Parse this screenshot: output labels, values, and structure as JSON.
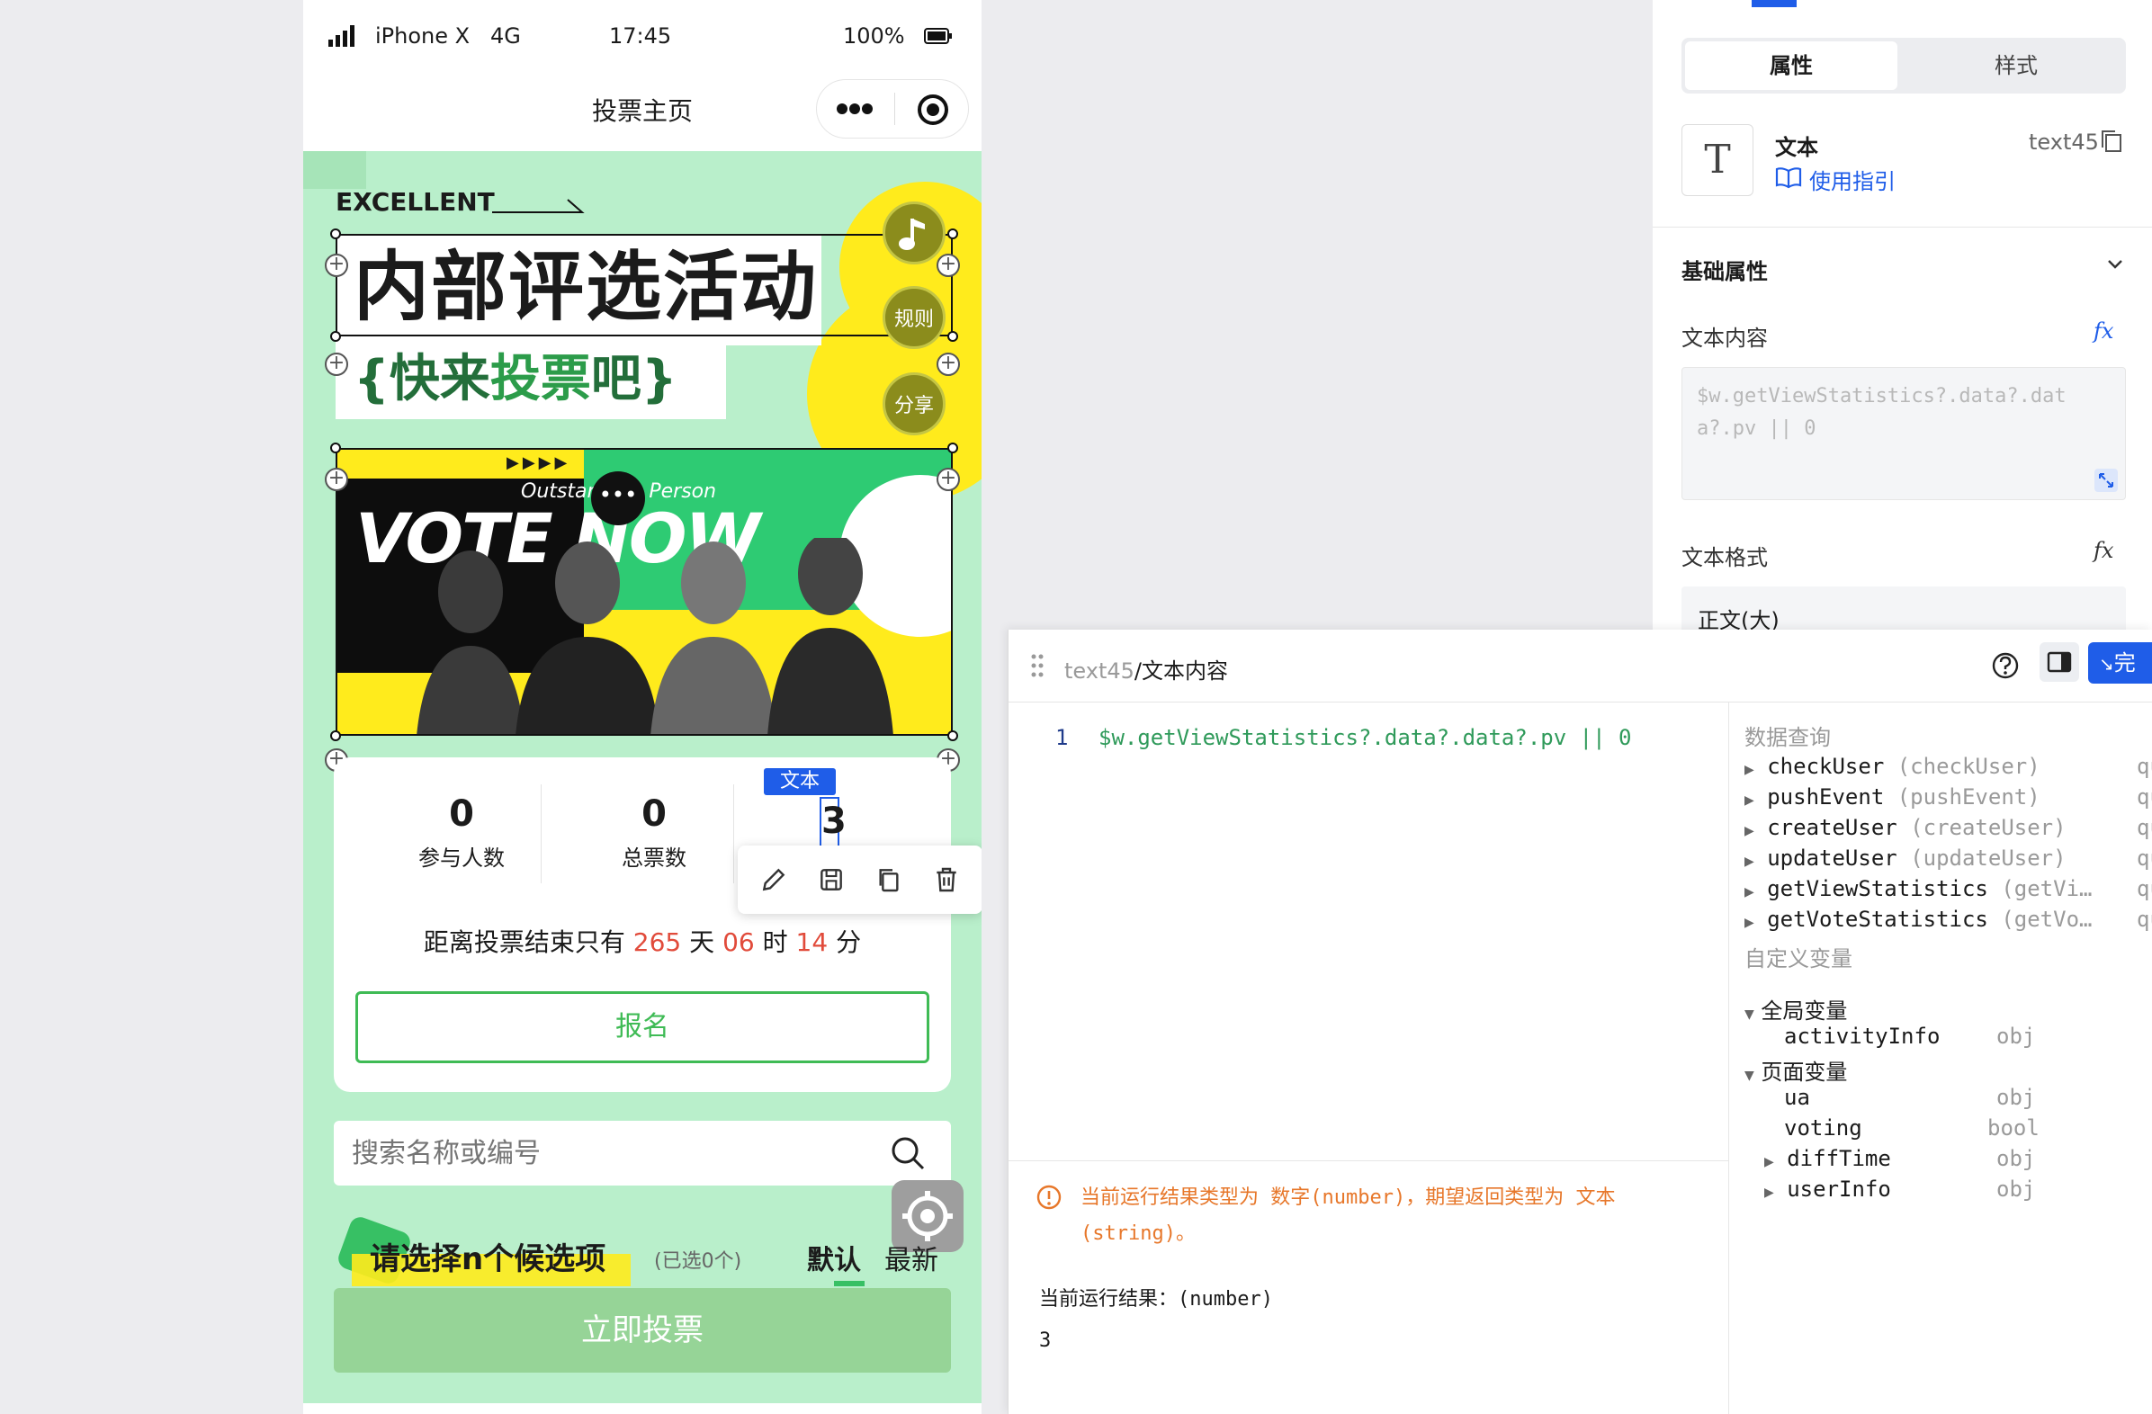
{
  "status_bar": {
    "carrier": "iPhone X",
    "network": "4G",
    "time": "17:45",
    "battery": "100%"
  },
  "nav": {
    "title": "投票主页"
  },
  "hero": {
    "tag": "EXCELLENT",
    "title": "内部评选活动",
    "subtitle_pre": "{快来",
    "subtitle_hl": "投票",
    "subtitle_post": "吧}",
    "rules_btn": "规则",
    "share_btn": "分享",
    "banner_small": "Outstanding Person",
    "banner_big": "VOTE NOW"
  },
  "stats": {
    "participants_value": "0",
    "participants_label": "参与人数",
    "total_votes_value": "0",
    "total_votes_label": "总票数",
    "views_value": "3",
    "text_badge": "文本",
    "countdown_pre": "距离投票结束只有",
    "days": "265",
    "days_unit": "天",
    "hours": "06",
    "hours_unit": "时",
    "minutes": "14",
    "minutes_unit": "分",
    "signup_label": "报名"
  },
  "search": {
    "placeholder": "搜索名称或编号"
  },
  "list_header": {
    "title": "请选择n个候选项",
    "selected": "(已选0个)",
    "sort_default": "默认",
    "sort_new": "最新"
  },
  "vote_button": "立即投票",
  "property_panel": {
    "tabs": [
      "属性",
      "样式"
    ],
    "component_name": "文本",
    "component_id": "text45",
    "guide_link": "使用指引",
    "section_basic": "基础属性",
    "content_label": "文本内容",
    "content_value": "$w.getViewStatistics?.data?.data?.pv || 0",
    "format_label": "文本格式",
    "format_value": "正文(大)",
    "fx": "fx"
  },
  "editor": {
    "breadcrumb_id": "text45",
    "breadcrumb_sep": "/",
    "breadcrumb_field": "文本内容",
    "line_no": "1",
    "code": "$w.getViewStatistics?.data?.data?.pv || 0",
    "warning": "当前运行结果类型为 数字(number)，期望返回类型为 文本(string)。",
    "result_label": "当前运行结果：(number)",
    "result_value": "3",
    "confirm_btn": "完"
  },
  "data_tree": {
    "queries_title": "数据查询",
    "queries": [
      {
        "name": "checkUser",
        "alias": "(checkUser)",
        "kind": "qu"
      },
      {
        "name": "pushEvent",
        "alias": "(pushEvent)",
        "kind": "qu"
      },
      {
        "name": "createUser",
        "alias": "(createUser)",
        "kind": "qu"
      },
      {
        "name": "updateUser",
        "alias": "(updateUser)",
        "kind": "qu"
      },
      {
        "name": "getViewStatistics",
        "alias": "(getVi…",
        "kind": "qu"
      },
      {
        "name": "getVoteStatistics",
        "alias": "(getVo…",
        "kind": "qu"
      }
    ],
    "custom_title": "自定义变量",
    "global_vars": "全局变量",
    "global_items": [
      {
        "name": "activityInfo",
        "type": "obj"
      }
    ],
    "page_vars": "页面变量",
    "page_items": [
      {
        "name": "ua",
        "type": "obj"
      },
      {
        "name": "voting",
        "type": "bool"
      },
      {
        "name": "diffTime",
        "type": "obj"
      },
      {
        "name": "userInfo",
        "type": "obj"
      }
    ]
  },
  "colors": {
    "accent": "#1f5de8",
    "green": "#3fbb55",
    "red": "#e14b3b",
    "warning": "#e7772a",
    "code": "#2f9a5a"
  }
}
